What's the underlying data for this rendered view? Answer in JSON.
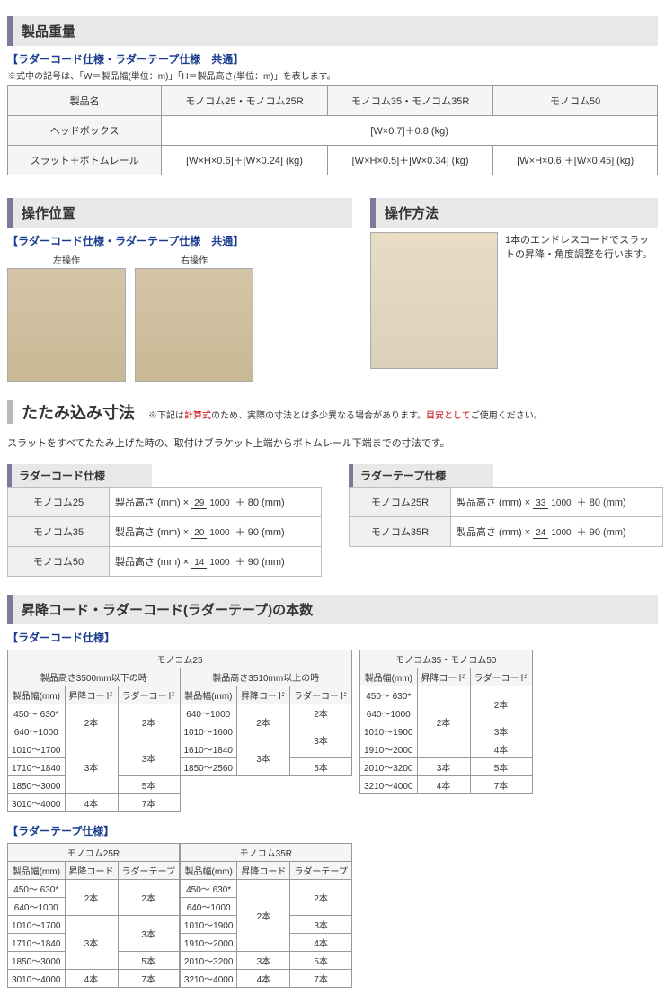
{
  "weight": {
    "title": "製品重量",
    "subheader": "【ラダーコード仕様・ラダーテープ仕様　共通】",
    "note": "※式中の記号は、「W＝製品幅(単位：m)」「H＝製品高さ(単位：m)」を表します。",
    "headers": [
      "製品名",
      "モノコム25・モノコム25R",
      "モノコム35・モノコム35R",
      "モノコム50"
    ],
    "row1_label": "ヘッドボックス",
    "row1_val": "[W×0.7]＋0.8 (kg)",
    "row2_label": "スラット＋ボトムレール",
    "row2_vals": [
      "[W×H×0.6]＋[W×0.24] (kg)",
      "[W×H×0.5]＋[W×0.34] (kg)",
      "[W×H×0.6]＋[W×0.45] (kg)"
    ]
  },
  "operation": {
    "pos_title": "操作位置",
    "pos_sub": "【ラダーコード仕様・ラダーテープ仕様　共通】",
    "left_label": "左操作",
    "right_label": "右操作",
    "method_title": "操作方法",
    "method_desc": "1本のエンドレスコードでスラットの昇降・角度調整を行います。"
  },
  "fold": {
    "title": "たたみ込み寸法",
    "subtitle_a": "※下記は",
    "subtitle_b": "計算式",
    "subtitle_c": "のため、実際の寸法とは多少異なる場合があります。",
    "subtitle_d": "目安として",
    "subtitle_e": "ご使用ください。",
    "desc": "スラットをすべてたたみ上げた時の、取付けブラケット上端からボトムレール下端までの寸法です。",
    "ladder_cord_title": "ラダーコード仕様",
    "ladder_tape_title": "ラダーテープ仕様",
    "cord_rows": [
      {
        "name": "モノコム25",
        "prefix": "製品高さ (mm) ×",
        "num": "29",
        "den": "1000",
        "suffix": "＋ 80 (mm)"
      },
      {
        "name": "モノコム35",
        "prefix": "製品高さ (mm) ×",
        "num": "20",
        "den": "1000",
        "suffix": "＋ 90 (mm)"
      },
      {
        "name": "モノコム50",
        "prefix": "製品高さ (mm) ×",
        "num": "14",
        "den": "1000",
        "suffix": "＋ 90 (mm)"
      }
    ],
    "tape_rows": [
      {
        "name": "モノコム25R",
        "prefix": "製品高さ (mm) ×",
        "num": "33",
        "den": "1000",
        "suffix": "＋ 80 (mm)"
      },
      {
        "name": "モノコム35R",
        "prefix": "製品高さ (mm) ×",
        "num": "24",
        "den": "1000",
        "suffix": "＋ 90 (mm)"
      }
    ]
  },
  "count": {
    "title": "昇降コード・ラダーコード(ラダーテープ)の本数",
    "cord_sub": "【ラダーコード仕様】",
    "tape_sub": "【ラダーテープ仕様】",
    "m25_title": "モノコム25",
    "m25_height1": "製品高さ3500mm以下の時",
    "m25_height2": "製品高さ3510mm以上の時",
    "col_width": "製品幅(mm)",
    "col_lift": "昇降コード",
    "col_ladder_cord": "ラダーコード",
    "col_ladder_tape": "ラダーテープ",
    "m25_left": {
      "widths": [
        "450～ 630*",
        "640～1000",
        "1010～1700",
        "1710～1840",
        "1850～3000",
        "3010～4000"
      ],
      "lift": [
        "2本",
        "2本",
        "3本",
        "3本",
        "3本",
        "4本"
      ],
      "ladder": [
        "2本",
        "2本",
        "3本",
        "3本",
        "5本",
        "7本"
      ]
    },
    "m25_right": {
      "widths": [
        "640～1000",
        "1010～1600",
        "1610～1840",
        "1850～2560"
      ],
      "lift": [
        "2本",
        "2本",
        "3本",
        "3本"
      ],
      "ladder": [
        "2本",
        "3本",
        "3本",
        "5本"
      ]
    },
    "m35_50_title": "モノコム35・モノコム50",
    "m35_50": {
      "widths": [
        "450～ 630*",
        "640～1000",
        "1010～1900",
        "1910～2000",
        "2010～3200",
        "3210～4000"
      ],
      "lift": [
        "2本",
        "2本",
        "2本",
        "2本",
        "3本",
        "4本"
      ],
      "ladder": [
        "2本",
        "2本",
        "3本",
        "4本",
        "5本",
        "7本"
      ]
    },
    "m25r_title": "モノコム25R",
    "m25r": {
      "widths": [
        "450～ 630*",
        "640～1000",
        "1010～1700",
        "1710～1840",
        "1850～3000",
        "3010～4000"
      ],
      "lift": [
        "2本",
        "2本",
        "3本",
        "3本",
        "3本",
        "4本"
      ],
      "tape": [
        "2本",
        "2本",
        "3本",
        "3本",
        "5本",
        "7本"
      ]
    },
    "m35r_title": "モノコム35R",
    "m35r": {
      "widths": [
        "450～ 630*",
        "640～1000",
        "1010～1900",
        "1910～2000",
        "2010～3200",
        "3210～4000"
      ],
      "lift": [
        "2本",
        "2本",
        "2本",
        "2本",
        "3本",
        "4本"
      ],
      "tape": [
        "2本",
        "2本",
        "3本",
        "4本",
        "5本",
        "7本"
      ]
    }
  }
}
